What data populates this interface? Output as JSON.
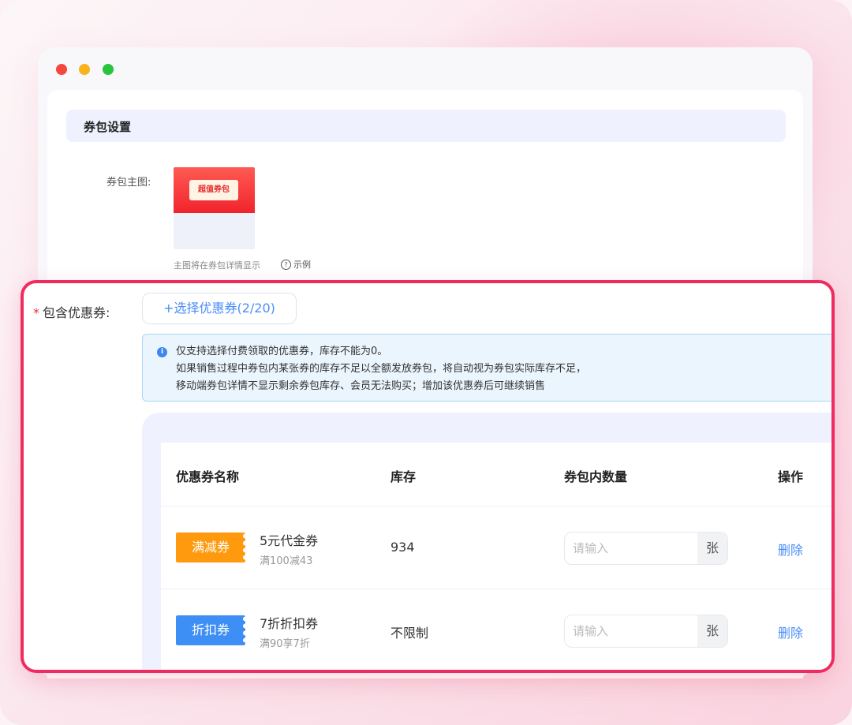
{
  "section": {
    "title": "券包设置"
  },
  "cover": {
    "label": "券包主图:",
    "image_text": "超值券包",
    "hint": "主图将在券包详情显示",
    "example_label": "示例"
  },
  "coupons": {
    "required_mark": "*",
    "label": "包含优惠券:",
    "select_button": "+选择优惠券(2/20)",
    "notice_lines": [
      "仅支持选择付费领取的优惠券，库存不能为0。",
      "如果销售过程中券包内某张券的库存不足以全额发放券包，将自动视为券包实际库存不足，",
      "移动端券包详情不显示剩余券包库存、会员无法购买；增加该优惠券后可继续销售"
    ],
    "headers": {
      "name": "优惠券名称",
      "stock": "库存",
      "qty": "券包内数量",
      "action": "操作"
    },
    "rows": [
      {
        "tag": "满减券",
        "tag_color": "#ff9a0e",
        "name": "5元代金券",
        "condition": "满100减43",
        "stock": "934",
        "qty_placeholder": "请输入",
        "unit": "张",
        "action": "删除"
      },
      {
        "tag": "折扣券",
        "tag_color": "#3e8ff5",
        "name": "7折折扣券",
        "condition": "满90享7折",
        "stock": "不限制",
        "qty_placeholder": "请输入",
        "unit": "张",
        "action": "删除"
      }
    ]
  },
  "colors": {
    "accent_blue": "#4a8df8",
    "highlight_border": "#ef2c5f",
    "required_red": "#e8333b"
  }
}
